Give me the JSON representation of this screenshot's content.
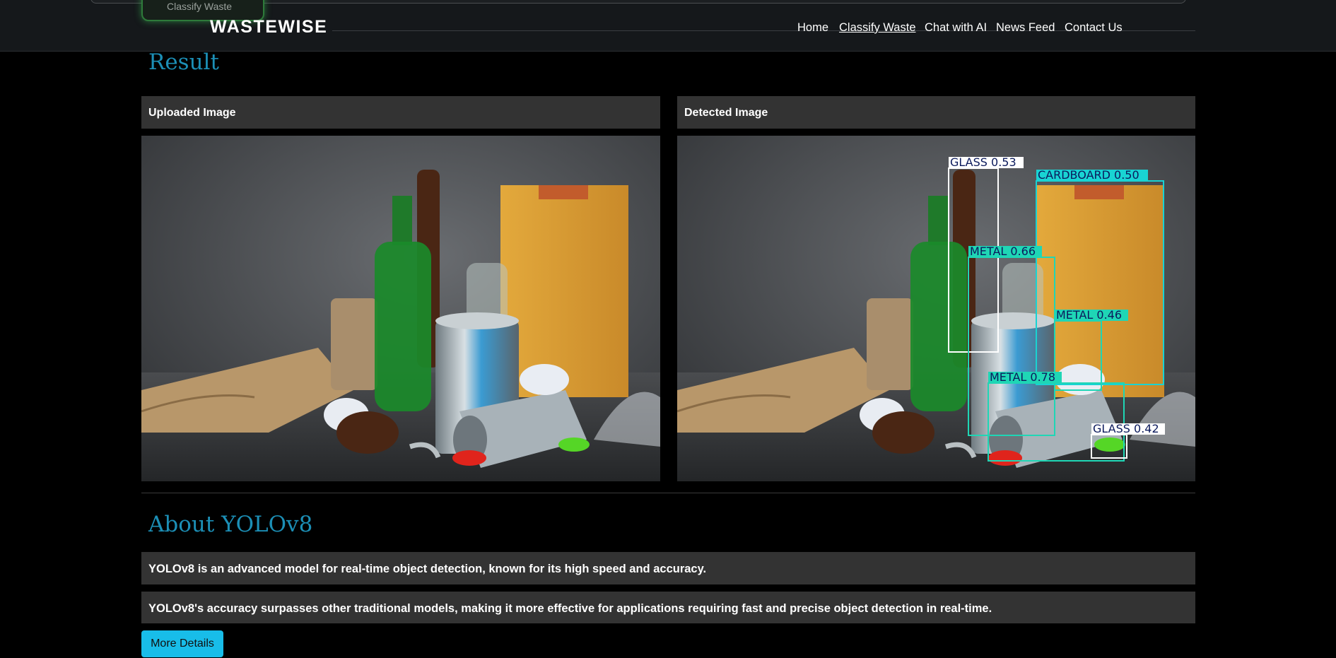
{
  "ghost_tab": "Classify Waste",
  "brand": "WASTEWISE",
  "nav": [
    "Home",
    "Classify Waste",
    "Chat with AI",
    "News Feed",
    "Contact Us"
  ],
  "result": {
    "title": "Result",
    "uploaded_label": "Uploaded Image",
    "detected_label": "Detected Image"
  },
  "detections": [
    {
      "label": "GLASS 0.53",
      "color": "#ffffff",
      "text_color": "#0b1a5c"
    },
    {
      "label": "CARDBOARD 0.50",
      "color": "#19d3d3",
      "text_color": "#0b1a5c"
    },
    {
      "label": "METAL 0.66",
      "color": "#1fd6b5",
      "text_color": "#0b1a5c"
    },
    {
      "label": "METAL 0.46",
      "color": "#1fd6b5",
      "text_color": "#0b1a5c"
    },
    {
      "label": "METAL 0.78",
      "color": "#1fd6b5",
      "text_color": "#0b1a5c"
    },
    {
      "label": "GLASS 0.42",
      "color": "#ffffff",
      "text_color": "#0b1a5c"
    }
  ],
  "about": {
    "title": "About YOLOv8",
    "p1": "YOLOv8 is an advanced model for real-time object detection, known for its high speed and accuracy.",
    "p2": "YOLOv8's accuracy surpasses other traditional models, making it more effective for applications requiring fast and precise object detection in real-time.",
    "button": "More Details"
  },
  "colors": {
    "accent": "#1c8fb6",
    "button": "#18bde9",
    "panel": "#333333",
    "header": "#15181b"
  }
}
